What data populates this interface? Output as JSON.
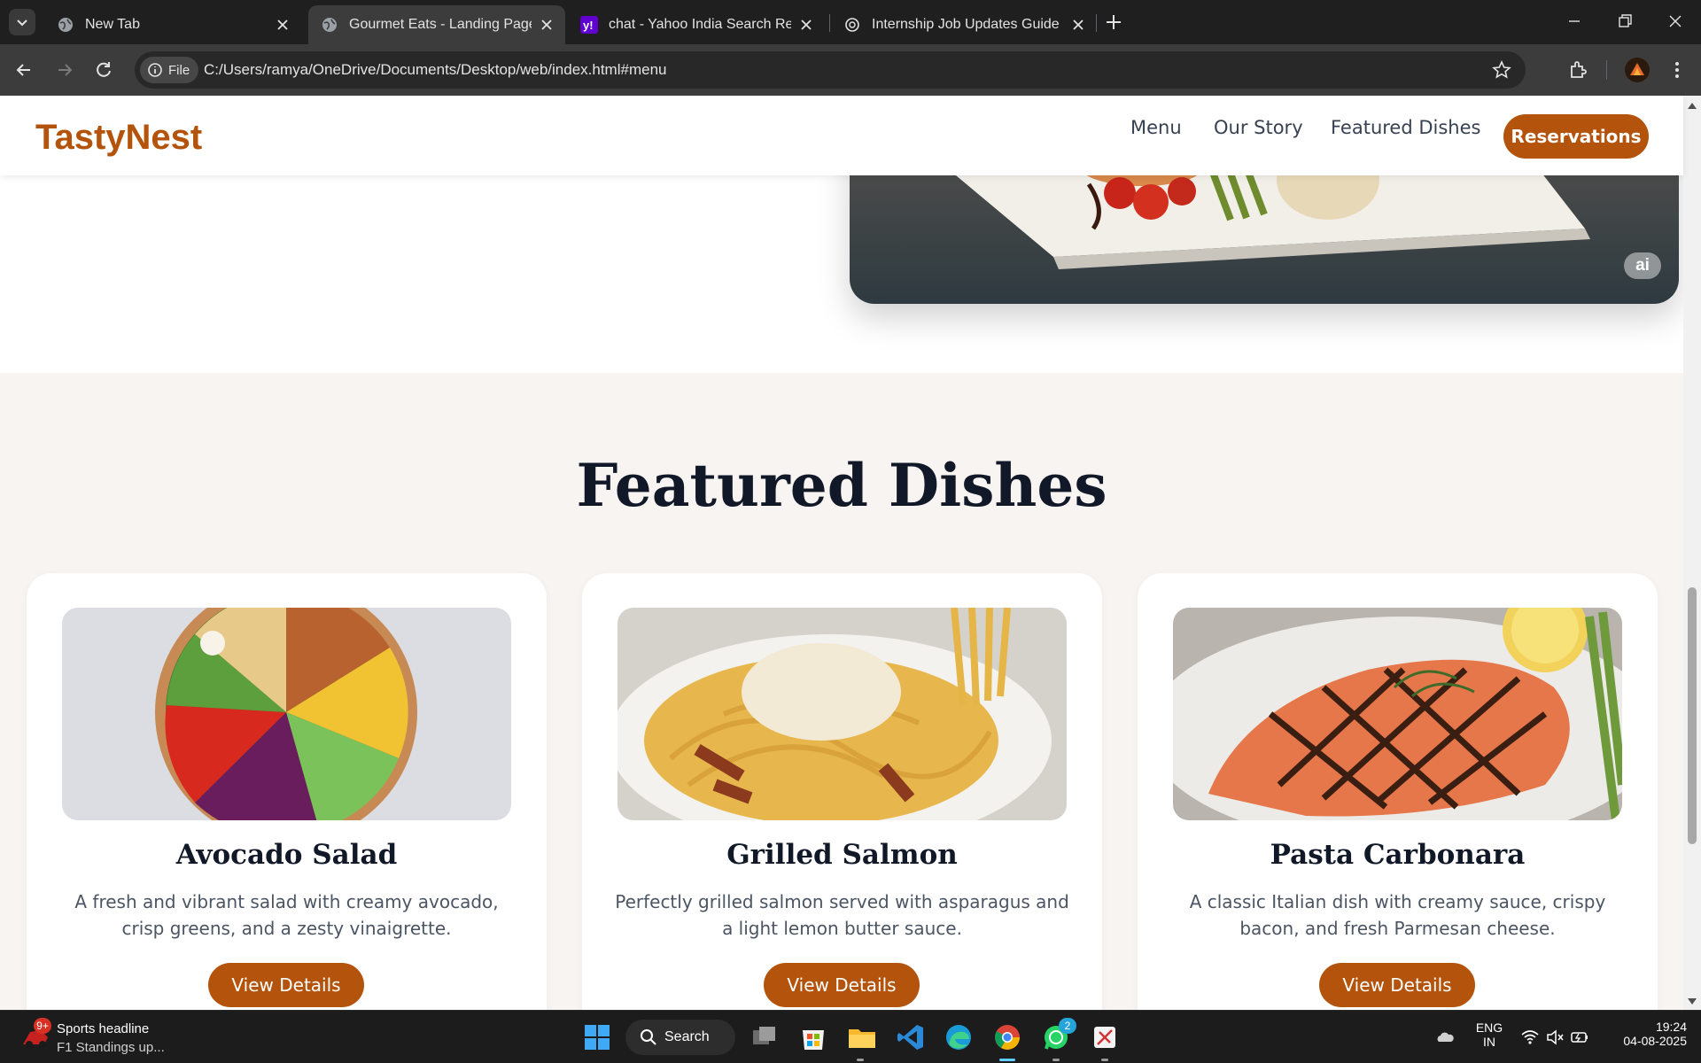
{
  "browser": {
    "tabs": [
      {
        "title": "New Tab",
        "icon": "globe-icon",
        "active": false
      },
      {
        "title": "Gourmet Eats - Landing Page",
        "icon": "globe-icon",
        "active": true
      },
      {
        "title": "chat - Yahoo India Search Results",
        "icon": "yahoo-icon",
        "active": false
      },
      {
        "title": "Internship Job Updates Guide",
        "icon": "openai-icon",
        "active": false
      }
    ],
    "chip_label": "File",
    "url": "C:/Users/ramya/OneDrive/Documents/Desktop/web/index.html#menu"
  },
  "site": {
    "brand": "TastyNest",
    "nav": [
      "Menu",
      "Our Story",
      "Featured Dishes"
    ],
    "cta": "Reservations",
    "hero_badge": "ai",
    "featured_title": "Featured Dishes",
    "dishes": [
      {
        "name": "Avocado Salad",
        "desc": "A fresh and vibrant salad with creamy avocado, crisp greens, and a zesty vinaigrette.",
        "button": "View Details"
      },
      {
        "name": "Grilled Salmon",
        "desc": "Perfectly grilled salmon served with asparagus and a light lemon butter sauce.",
        "button": "View Details"
      },
      {
        "name": "Pasta Carbonara",
        "desc": "A classic Italian dish with creamy sauce, crispy bacon, and fresh Parmesan cheese.",
        "button": "View Details"
      }
    ],
    "accent_color": "#b4530b"
  },
  "taskbar": {
    "news_badge": "9+",
    "news_title": "Sports headline",
    "news_subtitle": "F1 Standings up...",
    "search_label": "Search",
    "whatsapp_badge": "2",
    "lang_line1": "ENG",
    "lang_line2": "IN",
    "time": "19:24",
    "date": "04-08-2025"
  }
}
